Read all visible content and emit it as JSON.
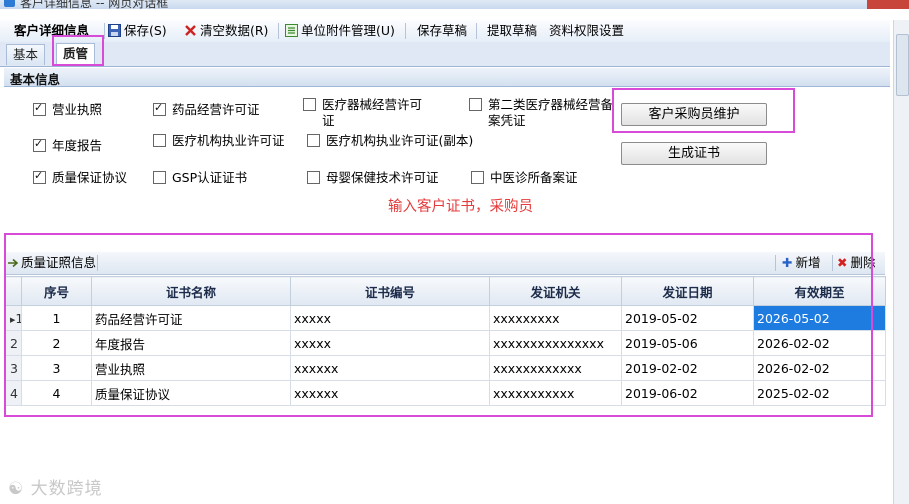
{
  "window": {
    "title": "客户详细信息 -- 网页对话框"
  },
  "toolbar": {
    "title": "客户详细信息",
    "save_label": "保存(S)",
    "clear_label": "清空数据(R)",
    "attach_label": "单位附件管理(U)",
    "save_draft_label": "保存草稿",
    "fetch_draft_label": "提取草稿",
    "perm_label": "资料权限设置"
  },
  "tabs": [
    {
      "label": "基本"
    },
    {
      "label": "质管"
    }
  ],
  "section": {
    "title": "基本信息"
  },
  "checkboxes": [
    {
      "label": "营业执照",
      "checked": true
    },
    {
      "label": "药品经营许可证",
      "checked": true
    },
    {
      "label": "医疗器械经营许可证",
      "checked": false
    },
    {
      "label": "第二类医疗器械经营备案凭证",
      "checked": false
    },
    {
      "label": "年度报告",
      "checked": true
    },
    {
      "label": "医疗机构执业许可证",
      "checked": false
    },
    {
      "label": "医疗机构执业许可证(副本)",
      "checked": false
    },
    {
      "label": "质量保证协议",
      "checked": true
    },
    {
      "label": "GSP认证证书",
      "checked": false
    },
    {
      "label": "母婴保健技术许可证",
      "checked": false
    },
    {
      "label": "中医诊所备案证",
      "checked": false
    }
  ],
  "buttons": {
    "buyer_maintain": "客户采购员维护",
    "generate_cert": "生成证书"
  },
  "annotation": "输入客户证书，采购员",
  "grid": {
    "title": "质量证照信息",
    "add_label": "新增",
    "delete_label": "删除",
    "columns": [
      "序号",
      "证书名称",
      "证书编号",
      "发证机关",
      "发证日期",
      "有效期至"
    ],
    "rows": [
      {
        "rownum": "1",
        "seq": "1",
        "name": "药品经营许可证",
        "number": "xxxxx",
        "authority": "xxxxxxxxx",
        "issue_date": "2019-05-02",
        "expiry": "2026-05-02"
      },
      {
        "rownum": "2",
        "seq": "2",
        "name": "年度报告",
        "number": "xxxxx",
        "authority": "xxxxxxxxxxxxxxx",
        "issue_date": "2019-05-06",
        "expiry": "2026-02-02"
      },
      {
        "rownum": "3",
        "seq": "3",
        "name": "营业执照",
        "number": "xxxxxx",
        "authority": "xxxxxxxxxxxx",
        "issue_date": "2019-02-02",
        "expiry": "2026-02-02"
      },
      {
        "rownum": "4",
        "seq": "4",
        "name": "质量保证协议",
        "number": "xxxxxx",
        "authority": "xxxxxxxxxxx",
        "issue_date": "2019-06-02",
        "expiry": "2025-02-02"
      }
    ]
  },
  "watermark": "大数跨境",
  "colors": {
    "highlight": "#d84ad8",
    "annotation": "#e43c3c",
    "selected_cell": "#1e7be0"
  }
}
